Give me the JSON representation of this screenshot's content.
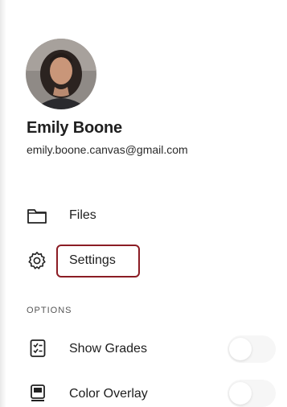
{
  "user": {
    "name": "Emily Boone",
    "email": "emily.boone.canvas@gmail.com",
    "avatar": "profile-photo"
  },
  "nav": {
    "files_label": "Files",
    "files_icon": "folder-icon",
    "settings_label": "Settings",
    "settings_icon": "gear-icon"
  },
  "options": {
    "header": "OPTIONS",
    "show_grades": {
      "label": "Show Grades",
      "icon": "grades-icon",
      "enabled": false
    },
    "color_overlay": {
      "label": "Color Overlay",
      "icon": "color-overlay-icon",
      "enabled": false
    }
  },
  "colors": {
    "highlight": "#8b1c24",
    "text": "#1f1f1f"
  }
}
